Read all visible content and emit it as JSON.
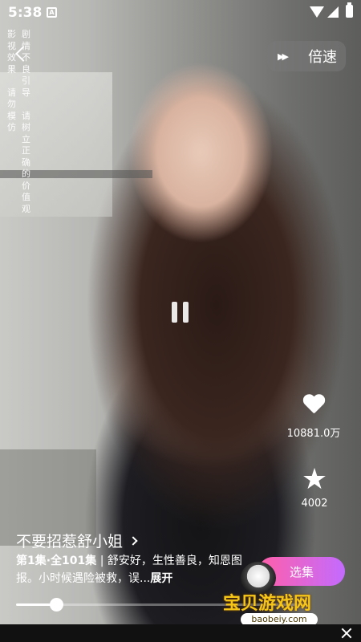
{
  "status_bar": {
    "time": "5:38",
    "notification_icon": "a-notification-icon",
    "notification_glyph": "A"
  },
  "disclaimer": {
    "column1": [
      "影",
      "视",
      "效",
      "果",
      "",
      "请",
      "勿",
      "模",
      "仿"
    ],
    "column2": [
      "剧",
      "情",
      "不",
      "良",
      "引",
      "导",
      "",
      "请",
      "树",
      "立",
      "正",
      "确",
      "的",
      "价",
      "值",
      "观"
    ]
  },
  "speed": {
    "label": "倍速",
    "icon": "fast-forward-icon"
  },
  "video": {
    "state": "playing",
    "overlay_icon": "pause-icon"
  },
  "actions": {
    "like_count": "10881.0万",
    "favorite_count": "4002"
  },
  "drama": {
    "title": "不要招惹舒小姐",
    "episode_info": "第1集·全101集",
    "description": " | 舒安好，生性善良，知恩图报。小时候遇险被救，误...",
    "expand_label": "展开"
  },
  "episode_button": {
    "label": "选集"
  },
  "progress": {
    "fraction": 0.14
  },
  "watermark": {
    "text": "宝贝游戏网",
    "url": "baobeiy.com"
  },
  "colors": {
    "accent_gradient_start": "#ff5fa8",
    "accent_gradient_end": "#c36bff",
    "watermark": "#f5c518"
  }
}
